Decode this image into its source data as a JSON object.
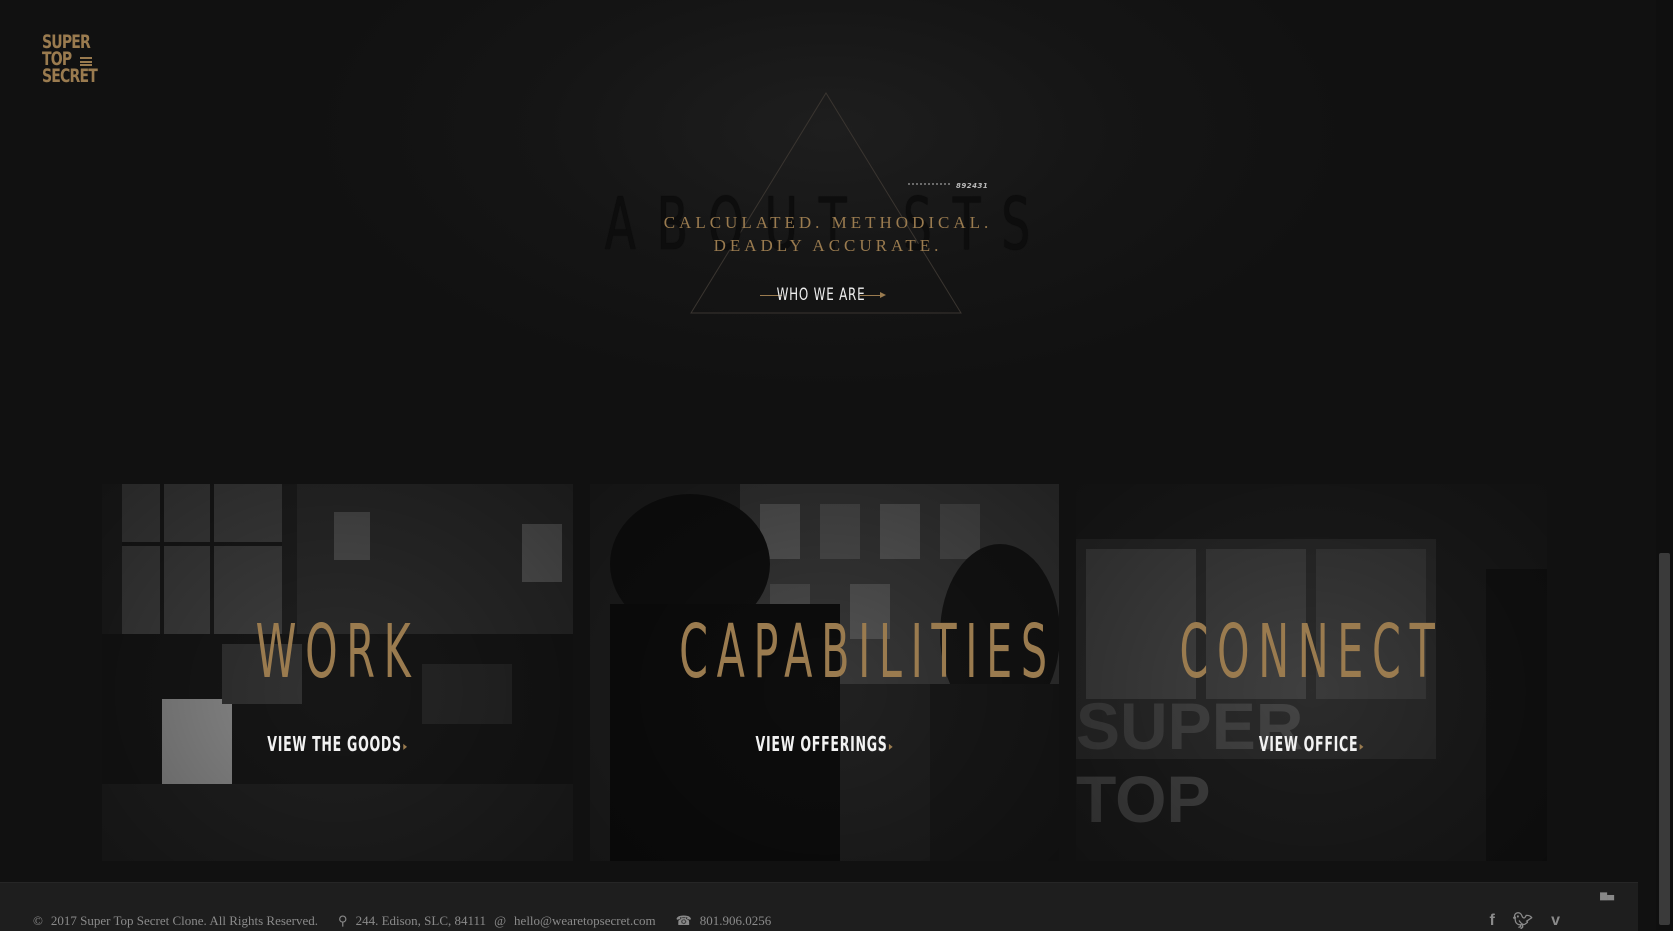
{
  "logo": {
    "lines": [
      "SUPER",
      "TOP",
      "SECRET"
    ]
  },
  "hero": {
    "serial": "892431",
    "ghost_title": "ABOUT STS",
    "tagline_line1": "CALCULATED. METHODICAL.",
    "tagline_line2": "DEADLY ACCURATE.",
    "cta_label": "WHO WE ARE"
  },
  "panels": [
    {
      "title": "WORK",
      "link": "VIEW THE GOODS"
    },
    {
      "title": "CAPABILITIES",
      "link": "VIEW OFFERINGS"
    },
    {
      "title": "CONNECT",
      "link": "VIEW OFFICE"
    }
  ],
  "footer": {
    "copyright": "2017 Super Top Secret Clone. All Rights Reserved.",
    "address": "244. Edison, SLC, 84111",
    "email": "hello@wearetopsecret.com",
    "phone": "801.906.0256",
    "social": [
      "facebook-icon",
      "twitter-icon",
      "vimeo-icon"
    ]
  },
  "colors": {
    "accent": "#9a7b4f",
    "background": "#121212",
    "footer": "#1e1e1e"
  }
}
